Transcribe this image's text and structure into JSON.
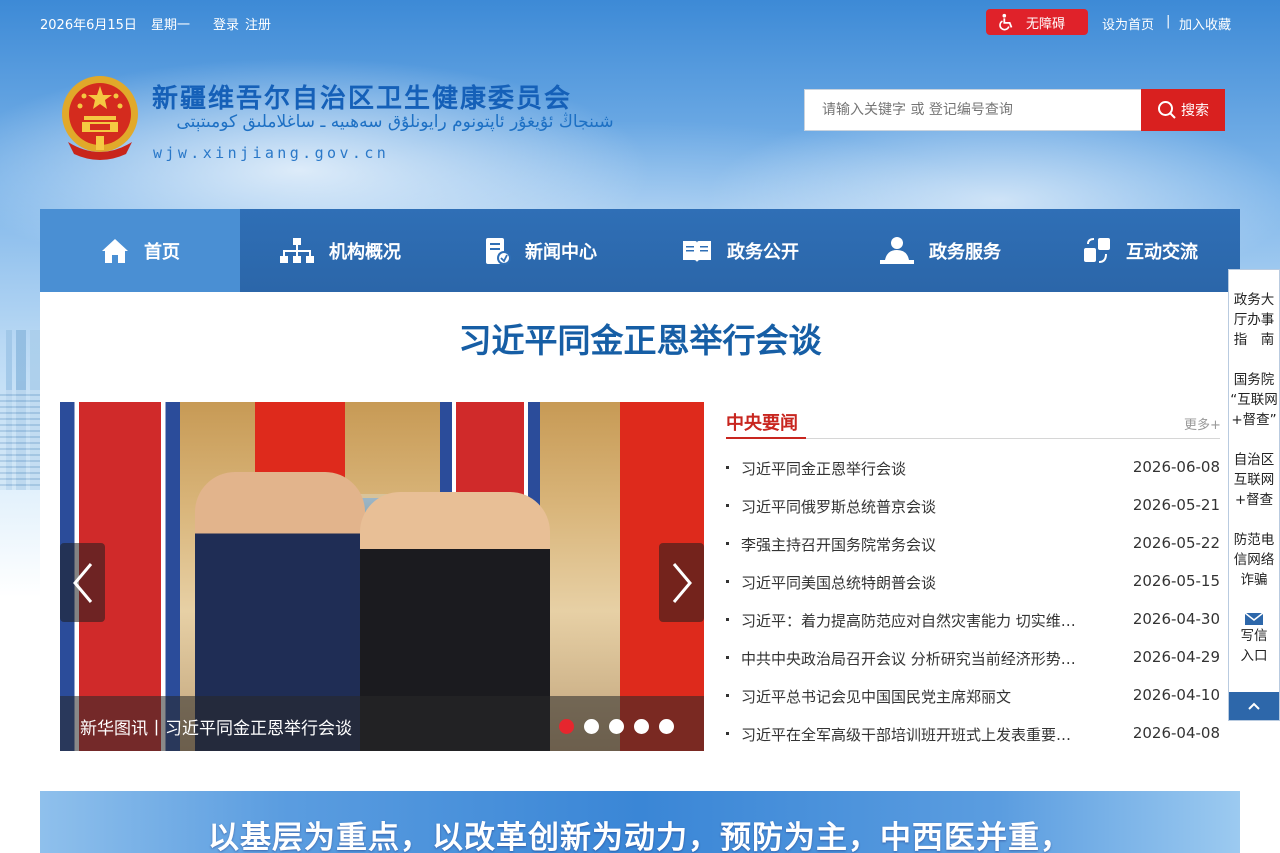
{
  "topbar": {
    "date": "2026年6月15日",
    "weekday": "星期一",
    "login": "登录",
    "register": "注册",
    "accessibility": "无障碍",
    "set_home": "设为首页",
    "separator": "|",
    "add_favorite": "加入收藏"
  },
  "header": {
    "title": "新疆维吾尔自治区卫生健康委员会",
    "title_uyghur": "شىنجاڭ ئۇيغۇر ئاپتونوم رايونلۇق سەھىيە ـ ساغلاملىق كومىتېتى",
    "domain": "wjw.xinjiang.gov.cn"
  },
  "search": {
    "placeholder": "请输入关键字 或 登记编号查询",
    "button": "搜索"
  },
  "nav": [
    {
      "label": "首页",
      "icon": "home-icon"
    },
    {
      "label": "机构概况",
      "icon": "org-chart-icon"
    },
    {
      "label": "新闻中心",
      "icon": "news-doc-icon"
    },
    {
      "label": "政务公开",
      "icon": "open-book-icon"
    },
    {
      "label": "政务服务",
      "icon": "service-person-icon"
    },
    {
      "label": "互动交流",
      "icon": "exchange-icon"
    }
  ],
  "headline": "习近平同金正恩举行会谈",
  "slideshow": {
    "caption": "新华图讯丨习近平同金正恩举行会谈",
    "active_dot": 1,
    "dot_count": 5
  },
  "news": {
    "tab": "中央要闻",
    "more": "更多+",
    "items": [
      {
        "title": "习近平同金正恩举行会谈",
        "date": "2026-06-08"
      },
      {
        "title": "习近平同俄罗斯总统普京会谈",
        "date": "2026-05-21"
      },
      {
        "title": "李强主持召开国务院常务会议",
        "date": "2026-05-22"
      },
      {
        "title": "习近平同美国总统特朗普会谈",
        "date": "2026-05-15"
      },
      {
        "title": "习近平：着力提高防范应对自然灾害能力 切实维…",
        "date": "2026-04-30"
      },
      {
        "title": "中共中央政治局召开会议 分析研究当前经济形势…",
        "date": "2026-04-29"
      },
      {
        "title": "习近平总书记会见中国国民党主席郑丽文",
        "date": "2026-04-10"
      },
      {
        "title": "习近平在全军高级干部培训班开班式上发表重要…",
        "date": "2026-04-08"
      }
    ]
  },
  "sidebar": {
    "items": [
      {
        "line1": "政务大",
        "line2": "厅办事",
        "line3": "指　南"
      },
      {
        "line1": "国务院",
        "line2": "“互联网",
        "line3": "+督查”"
      },
      {
        "line1": "自治区",
        "line2": "互联网",
        "line3": "+督查"
      },
      {
        "line1": "防范电",
        "line2": "信网络",
        "line3": "诈骗"
      },
      {
        "line1": "写信",
        "line2": "入口",
        "icon": "envelope-icon"
      }
    ]
  },
  "banner": {
    "text": "以基层为重点，以改革创新为动力，预防为主，中西医并重，"
  },
  "colors": {
    "nav_bg": "#2f6fb6",
    "nav_active": "#4a8fd3",
    "accent_red": "#d9201f",
    "headline": "#165ea5"
  }
}
